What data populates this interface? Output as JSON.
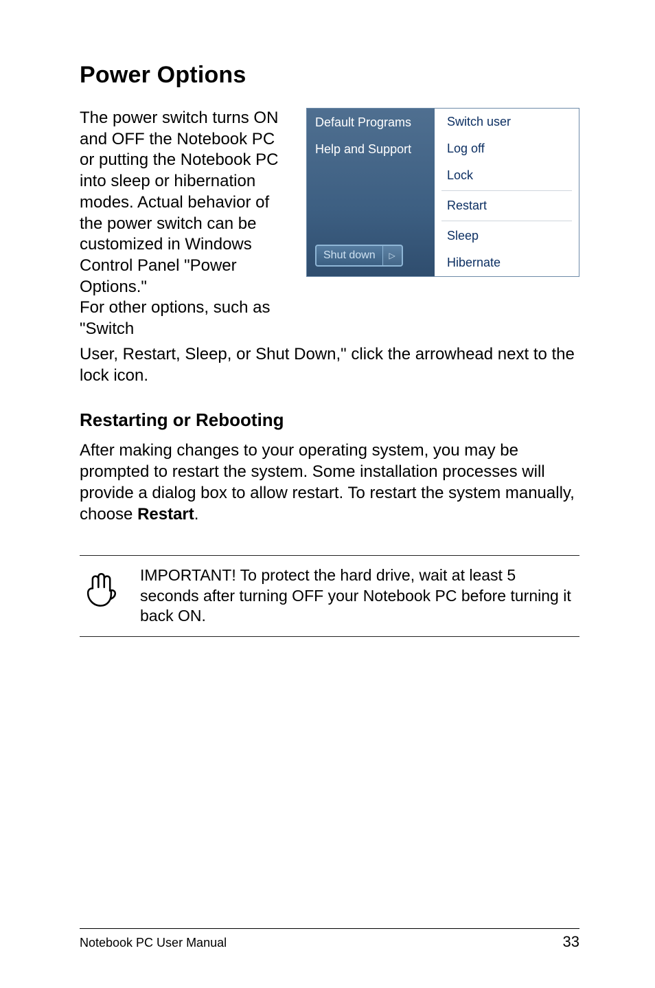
{
  "section": {
    "title": "Power Options",
    "intro_part1": "The power switch turns ON and OFF the Notebook PC or putting the Notebook PC into sleep or hibernation modes. Actual behavior of the power switch can be customized in Windows Control Panel \"Power Options.\"",
    "intro_part2": "For other options, such as \"Switch",
    "intro_after": "User, Restart, Sleep, or Shut Down,\" click the arrowhead next to the lock icon."
  },
  "startmenu": {
    "left_items": [
      "Default Programs",
      "Help and Support"
    ],
    "shutdown_label": "Shut down",
    "arrow_glyph": "▷",
    "right_items_top": [
      "Switch user",
      "Log off",
      "Lock"
    ],
    "right_items_bottom": [
      "Restart",
      "Sleep",
      "Hibernate"
    ]
  },
  "subsection": {
    "heading": "Restarting or Rebooting",
    "para_before_bold": "After making changes to your operating system, you may be prompted to restart the system. Some installation processes will provide a dialog box to allow restart. To restart the system manually, choose ",
    "bold_word": "Restart",
    "para_after_bold": "."
  },
  "note": {
    "text": "IMPORTANT!  To protect the hard drive, wait at least 5 seconds after turning OFF your Notebook PC before turning it back ON."
  },
  "footer": {
    "left": "Notebook PC User Manual",
    "right": "33"
  }
}
